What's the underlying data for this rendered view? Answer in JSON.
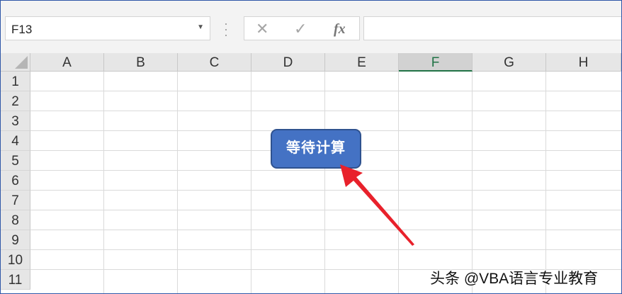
{
  "formula_bar": {
    "name_box": "F13",
    "dropdown_icon": "chevron-down-icon",
    "cancel_icon": "close-icon",
    "enter_icon": "checkmark-icon",
    "fx_label": "fx",
    "formula_value": ""
  },
  "columns": [
    "A",
    "B",
    "C",
    "D",
    "E",
    "F",
    "G",
    "H"
  ],
  "selected_column": "F",
  "rows": [
    "1",
    "2",
    "3",
    "4",
    "5",
    "6",
    "7",
    "8",
    "9",
    "10",
    "11"
  ],
  "button": {
    "label": "等待计算",
    "color": "#4472c4"
  },
  "annotation": {
    "arrow_color": "#e8212b"
  },
  "watermark": "头条 @VBA语言专业教育"
}
